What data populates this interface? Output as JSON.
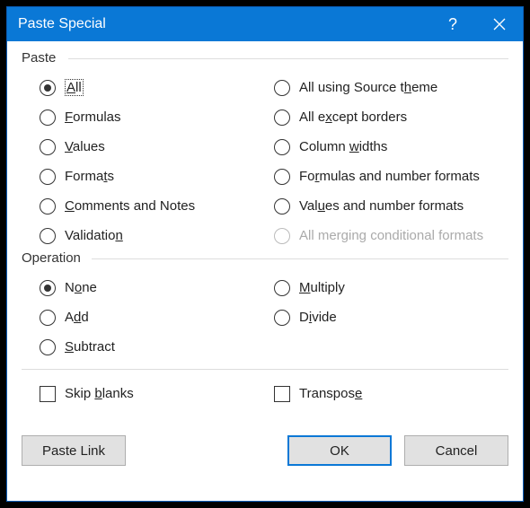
{
  "titlebar": {
    "title": "Paste Special",
    "help": "?",
    "close": "✕"
  },
  "groups": {
    "paste_label": "Paste",
    "operation_label": "Operation"
  },
  "paste": {
    "left": [
      {
        "pre": "",
        "ul": "A",
        "post": "ll",
        "selected": true,
        "focused": true
      },
      {
        "pre": "",
        "ul": "F",
        "post": "ormulas"
      },
      {
        "pre": "",
        "ul": "V",
        "post": "alues"
      },
      {
        "pre": "Forma",
        "ul": "t",
        "post": "s"
      },
      {
        "pre": "",
        "ul": "C",
        "post": "omments and Notes"
      },
      {
        "pre": "Validatio",
        "ul": "n",
        "post": ""
      }
    ],
    "right": [
      {
        "pre": "All using Source t",
        "ul": "h",
        "post": "eme"
      },
      {
        "pre": "All e",
        "ul": "x",
        "post": "cept borders"
      },
      {
        "pre": "Column ",
        "ul": "w",
        "post": "idths"
      },
      {
        "pre": "Fo",
        "ul": "r",
        "post": "mulas and number formats"
      },
      {
        "pre": "Val",
        "ul": "u",
        "post": "es and number formats"
      },
      {
        "pre": "All merging conditional formats",
        "ul": "",
        "post": "",
        "disabled": true
      }
    ]
  },
  "operation": {
    "left": [
      {
        "pre": "N",
        "ul": "o",
        "post": "ne",
        "selected": true
      },
      {
        "pre": "A",
        "ul": "d",
        "post": "d"
      },
      {
        "pre": "",
        "ul": "S",
        "post": "ubtract"
      }
    ],
    "right": [
      {
        "pre": "",
        "ul": "M",
        "post": "ultiply"
      },
      {
        "pre": "D",
        "ul": "i",
        "post": "vide"
      }
    ]
  },
  "checks": {
    "skip": {
      "pre": "Skip ",
      "ul": "b",
      "post": "lanks"
    },
    "transpose": {
      "pre": "Transpos",
      "ul": "e",
      "post": ""
    }
  },
  "buttons": {
    "paste_link": "Paste Link",
    "ok": "OK",
    "cancel": "Cancel"
  }
}
